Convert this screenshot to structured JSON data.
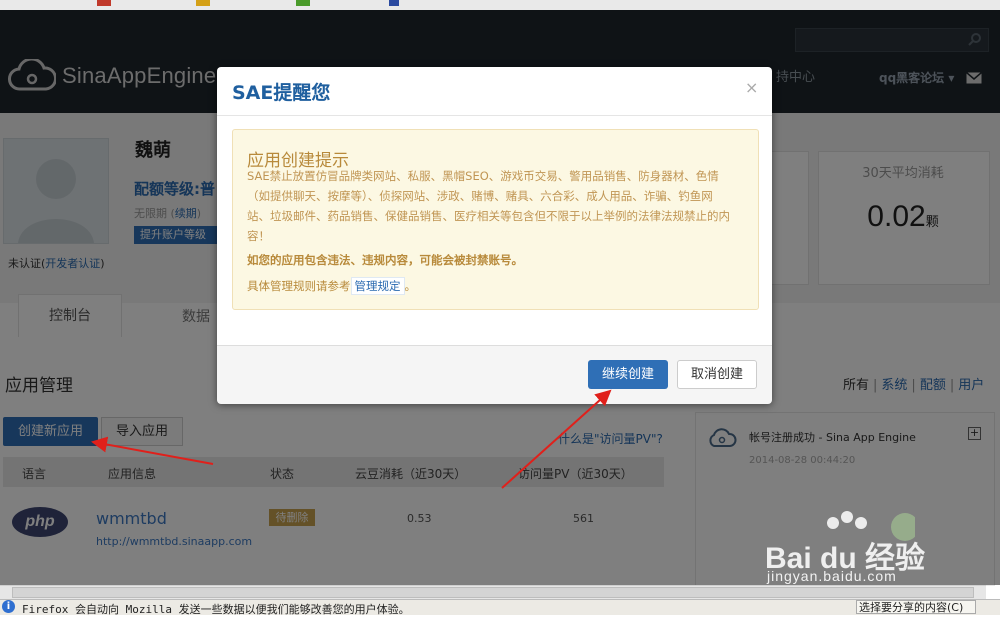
{
  "header": {
    "logo_text": "SinaAppEngine",
    "service_center": "持中心",
    "user_menu": "qq黑客论坛 ▾"
  },
  "profile": {
    "name": "魏萌",
    "quota_level": "配额等级:普",
    "quota_period_prefix": "无限期 (",
    "quota_period_link": "续期",
    "quota_period_suffix": ")",
    "upgrade_button": "提升账户等级",
    "cert_status": "未认证(",
    "cert_link": "开发者认证",
    "cert_suffix": ")",
    "stat_label": "30天平均消耗",
    "stat_value": "0.02",
    "stat_unit": "颗"
  },
  "tabs": {
    "console": "控制台",
    "data": "数据"
  },
  "apps": {
    "title": "应用管理",
    "filter_all": "所有",
    "filter_sys": "系统",
    "filter_quota": "配额",
    "filter_user": "用户",
    "create_button": "创建新应用",
    "import_button": "导入应用",
    "pv_help": "什么是\"访问量PV\"?",
    "columns": [
      "语言",
      "应用信息",
      "状态",
      "云豆消耗（近30天）",
      "访问量PV（近30天）"
    ],
    "rows": [
      {
        "lang": "php",
        "name": "wmmtbd",
        "url": "http://wmmtbd.sinaapp.com",
        "status": "待删除",
        "bean": "0.53",
        "pv": "561"
      }
    ]
  },
  "notification": {
    "title": "帐号注册成功 - Sina App Engine",
    "time": "2014-08-28 00:44:20",
    "expand": "+"
  },
  "modal": {
    "title": "SAE提醒您",
    "close": "×",
    "alert_heading": "应用创建提示",
    "alert_body": "SAE禁止放置仿冒品牌类网站、私服、黑帽SEO、游戏币交易、警用品销售、防身器材、色情（如提供聊天、按摩等）、侦探网站、涉政、赌博、赌具、六合彩、成人用品、诈骗、钓鱼网站、垃圾邮件、药品销售、保健品销售、医疗相关等包含但不限于以上举例的法律法规禁止的内容！",
    "alert_warning": "如您的应用包含违法、违规内容，可能会被封禁账号。",
    "alert_rules_prefix": "具体管理规则请参考",
    "alert_rules_link": "管理规定",
    "alert_rules_suffix": "。",
    "continue_button": "继续创建",
    "cancel_button": "取消创建"
  },
  "watermark": {
    "brand": "Bai du 经验",
    "url": "jingyan.baidu.com"
  },
  "statusbar": {
    "info_icon": "i",
    "message": "Firefox 会自动向 Mozilla 发送一些数据以便我们能够改善您的用户体验。",
    "share_button": "选择要分享的内容(C)"
  }
}
